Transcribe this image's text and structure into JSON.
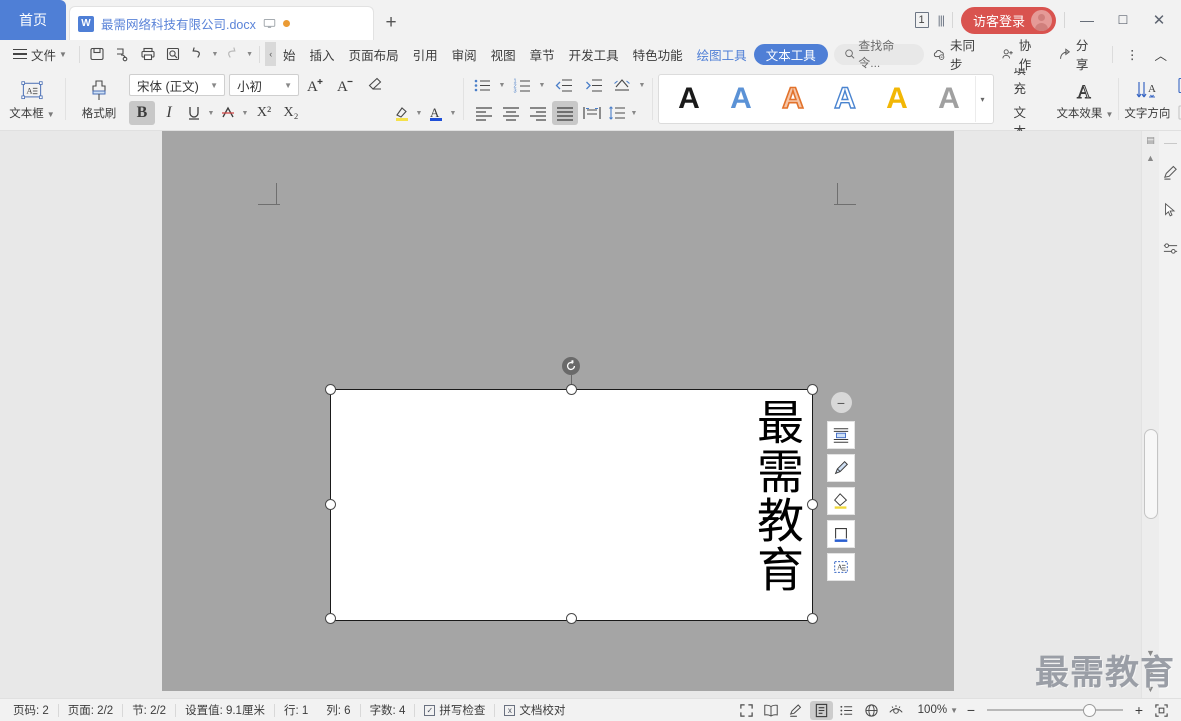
{
  "titlebar": {
    "home_tab": "首页",
    "doc_tab": {
      "name": "最需网络科技有限公司.docx",
      "badge": "W",
      "monitor_icon": "monitor-icon",
      "unsaved_dot": "unsaved-dot"
    },
    "new_tab": "+",
    "page_count": "1",
    "login_label": "访客登录",
    "minimize": "—",
    "maximize": "☐",
    "close": "✕"
  },
  "menubar": {
    "file_label": "文件",
    "quick_icons": [
      "save-icon",
      "save-as-icon",
      "print-icon",
      "print-preview-icon",
      "undo-icon",
      "redo-icon",
      "customize-icon"
    ],
    "scroll_left": "‹",
    "tabs": [
      {
        "label": "始",
        "style": "clipped"
      },
      {
        "label": "插入",
        "style": "normal"
      },
      {
        "label": "页面布局",
        "style": "normal"
      },
      {
        "label": "引用",
        "style": "normal"
      },
      {
        "label": "审阅",
        "style": "normal"
      },
      {
        "label": "视图",
        "style": "normal"
      },
      {
        "label": "章节",
        "style": "normal"
      },
      {
        "label": "开发工具",
        "style": "normal"
      },
      {
        "label": "特色功能",
        "style": "normal"
      },
      {
        "label": "绘图工具",
        "style": "link"
      },
      {
        "label": "文本工具",
        "style": "active"
      }
    ],
    "search_placeholder": "查找命令...",
    "right_items": [
      {
        "label": "未同步",
        "icon": "cloud-sync-icon"
      },
      {
        "label": "协作",
        "icon": "collaborate-icon"
      },
      {
        "label": "分享",
        "icon": "share-icon"
      }
    ],
    "more_icon": "⋮",
    "collapse_icon": "︿"
  },
  "ribbon": {
    "textbox_button": {
      "label": "文本框",
      "icon": "textbox-icon"
    },
    "format_painter": {
      "label": "格式刷",
      "icon": "format-painter-icon"
    },
    "font_name": "宋体 (正文)",
    "font_size": "小初",
    "grow_font": "A⁺",
    "shrink_font": "A⁻",
    "clear_format": "clear-format-icon",
    "bold": "B",
    "italic": "I",
    "underline": "U",
    "strikethrough": "A",
    "superscript": "X²",
    "subscript": "X₂",
    "highlight": "highlight-icon",
    "font_color": "font-color-icon",
    "bullets": "bullet-list-icon",
    "numbering": "numbered-list-icon",
    "decrease_indent": "decrease-indent-icon",
    "increase_indent": "increase-indent-icon",
    "sort": "sort-icon",
    "align_left": "align-left-icon",
    "align_center": "align-center-icon",
    "align_right": "align-right-icon",
    "align_justify": "align-justify-icon",
    "distribute": "distribute-icon",
    "line_spacing": "line-spacing-icon",
    "wordart_styles": [
      {
        "name": "wordart-black",
        "glyph": "A",
        "fill": "#1a1a1a",
        "outline": "none"
      },
      {
        "name": "wordart-blue",
        "glyph": "A",
        "fill": "#5b92d6",
        "outline": "none"
      },
      {
        "name": "wordart-orange-outline",
        "glyph": "A",
        "fill": "#f6c6a8",
        "outline": "#e2722b"
      },
      {
        "name": "wordart-white-blue-outline",
        "glyph": "A",
        "fill": "#ffffff",
        "outline": "#4a84d0"
      },
      {
        "name": "wordart-gold",
        "glyph": "A",
        "fill": "#f2b705",
        "outline": "none"
      },
      {
        "name": "wordart-gray",
        "glyph": "A",
        "fill": "#a0a0a0",
        "outline": "none"
      }
    ],
    "wordart_more": "▾",
    "text_fill": "文本填充",
    "text_outline": "文本轮廓",
    "text_effects": "文本效果",
    "text_direction": "文字方向",
    "align_objects_icons": [
      "align-object-icon-1",
      "align-object-icon-2",
      "align-object-icon-3",
      "align-object-icon-4"
    ]
  },
  "document": {
    "textbox_content": "最需教育",
    "float_toolbar": {
      "close": "−",
      "buttons": [
        "layout-options-icon",
        "fill-brush-icon",
        "shape-fill-icon",
        "shape-outline-icon",
        "text-frame-icon"
      ]
    },
    "rotation_handle": "rotate-icon"
  },
  "right_rail": {
    "icons": [
      "divider",
      "pen-tool-icon",
      "select-cursor-icon",
      "settings-sliders-icon"
    ]
  },
  "watermark": "最需教育",
  "statusbar": {
    "left_items": [
      "页码: 2",
      "页面: 2/2",
      "节: 2/2",
      "设置值: 9.1厘米",
      "行: 1",
      "列: 6",
      "字数: 4"
    ],
    "spell_check": "拼写检查",
    "doc_proof": "文档校对",
    "view_icons": [
      "fullscreen-icon",
      "read-mode-icon",
      "edit-mode-icon",
      "print-layout-icon",
      "outline-icon",
      "web-layout-icon",
      "eye-protect-icon"
    ],
    "zoom_level": "100%",
    "zoom_out": "−",
    "zoom_in": "+",
    "fit_page": "fit-page-icon"
  }
}
